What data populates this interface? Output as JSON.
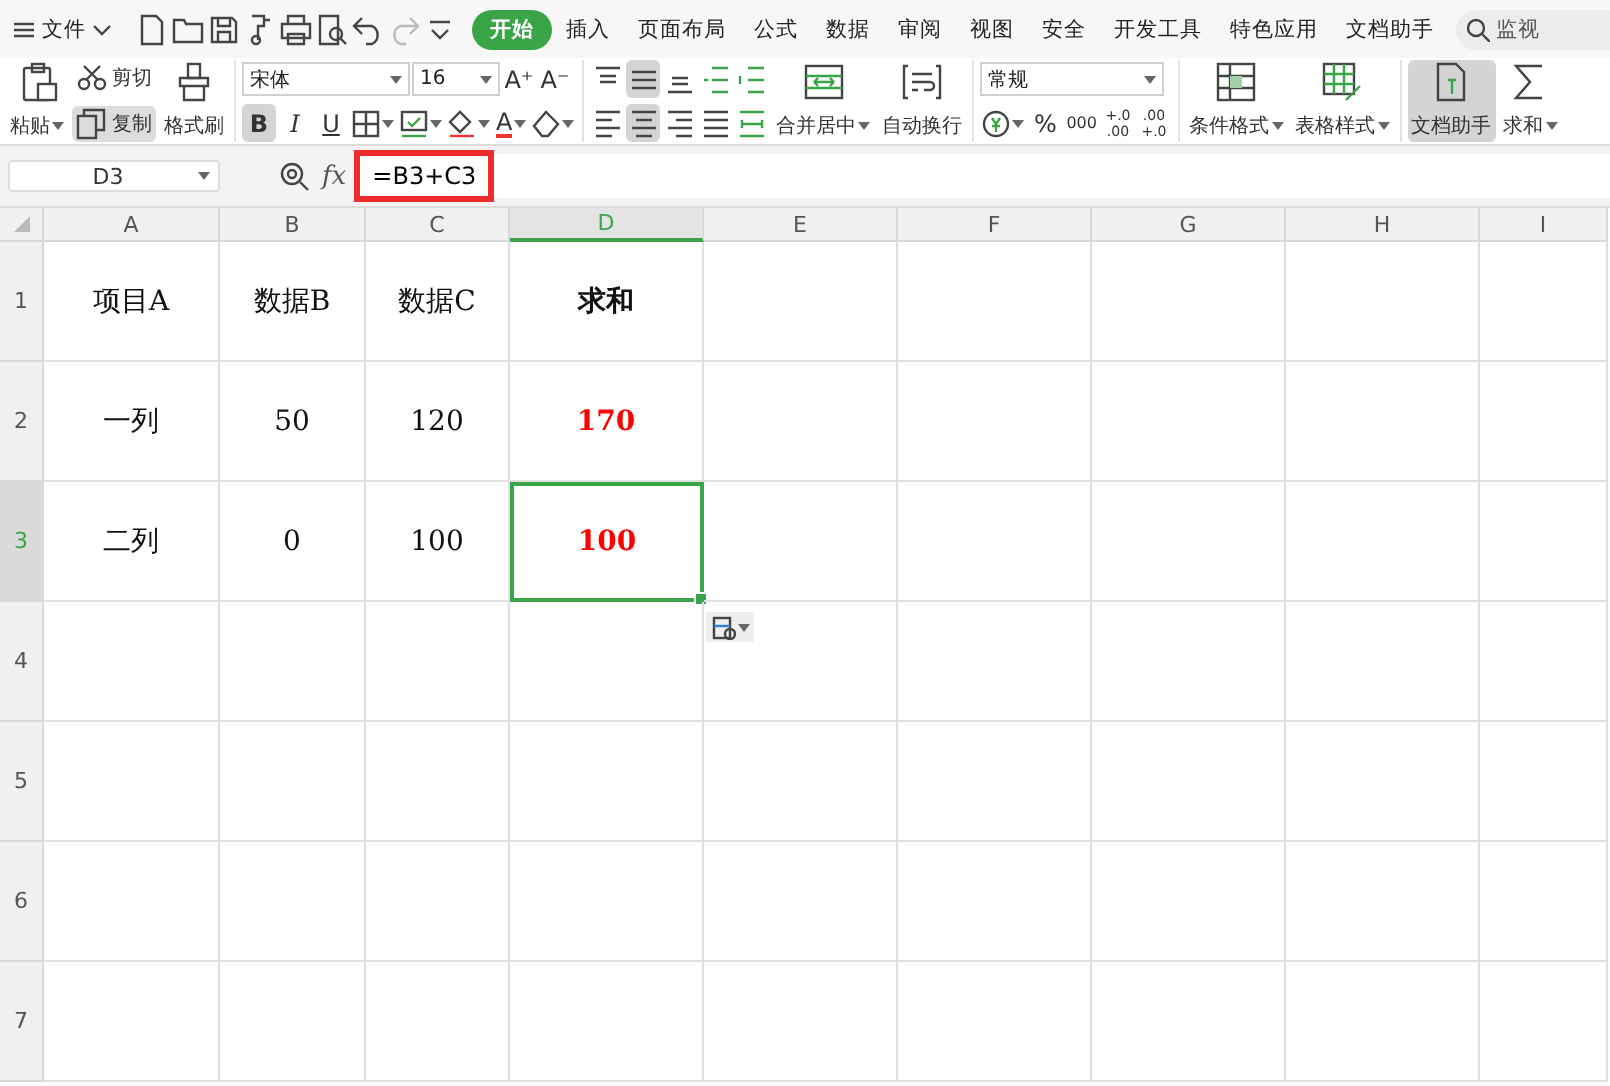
{
  "menu": {
    "file_label": "文件",
    "tabs": [
      {
        "label": "开始",
        "selected": true
      },
      {
        "label": "插入",
        "selected": false
      },
      {
        "label": "页面布局",
        "selected": false
      },
      {
        "label": "公式",
        "selected": false
      },
      {
        "label": "数据",
        "selected": false
      },
      {
        "label": "审阅",
        "selected": false
      },
      {
        "label": "视图",
        "selected": false
      },
      {
        "label": "安全",
        "selected": false
      },
      {
        "label": "开发工具",
        "selected": false
      },
      {
        "label": "特色应用",
        "selected": false
      },
      {
        "label": "文档助手",
        "selected": false
      }
    ],
    "search": {
      "placeholder": "监视"
    }
  },
  "ribbon": {
    "groups": [
      {
        "items": [
          {
            "kind": "large",
            "label": "粘贴",
            "dropdown": true,
            "active": false
          },
          {
            "kind": "stack",
            "items": [
              {
                "label": "剪切",
                "active": false
              },
              {
                "label": "复制",
                "active": true
              }
            ]
          },
          {
            "kind": "large",
            "label": "格式刷",
            "dropdown": false,
            "active": false
          }
        ]
      },
      {
        "items": [
          {
            "kind": "grid",
            "rows": [
              [
                {
                  "kind": "select",
                  "value": "宋体"
                },
                {
                  "kind": "select",
                  "value": "16"
                },
                {
                  "kind": "glyph",
                  "text": "A⁺",
                  "active": false,
                  "dropdown": false
                },
                {
                  "kind": "glyph",
                  "text": "A⁻",
                  "active": false,
                  "dropdown": false
                }
              ],
              [
                {
                  "kind": "glyph",
                  "text": "B",
                  "active": true,
                  "dropdown": false
                },
                {
                  "kind": "glyph",
                  "text": "I",
                  "active": false,
                  "dropdown": false
                },
                {
                  "kind": "glyph",
                  "text": "U",
                  "active": false,
                  "dropdown": false
                },
                {
                  "kind": "icon",
                  "active": false,
                  "dropdown": true
                },
                {
                  "kind": "icon",
                  "active": false,
                  "dropdown": true
                },
                {
                  "kind": "icon",
                  "active": false,
                  "dropdown": true
                },
                {
                  "kind": "glyph",
                  "text": "A",
                  "active": false,
                  "dropdown": true
                },
                {
                  "kind": "icon",
                  "active": false,
                  "dropdown": true
                }
              ]
            ]
          }
        ]
      },
      {
        "items": [
          {
            "kind": "grid",
            "rows": [
              [
                {
                  "kind": "icon",
                  "active": false,
                  "dropdown": false
                },
                {
                  "kind": "icon",
                  "active": true,
                  "dropdown": false
                },
                {
                  "kind": "icon",
                  "active": false,
                  "dropdown": false
                },
                {
                  "kind": "icon",
                  "active": false,
                  "dropdown": false
                },
                {
                  "kind": "icon",
                  "active": false,
                  "dropdown": false
                }
              ],
              [
                {
                  "kind": "icon",
                  "active": false,
                  "dropdown": false
                },
                {
                  "kind": "icon",
                  "active": true,
                  "dropdown": false
                },
                {
                  "kind": "icon",
                  "active": false,
                  "dropdown": false
                },
                {
                  "kind": "icon",
                  "active": false,
                  "dropdown": false
                },
                {
                  "kind": "icon",
                  "active": false,
                  "dropdown": false
                }
              ]
            ]
          },
          {
            "kind": "large",
            "label": "合并居中",
            "dropdown": true,
            "active": false
          },
          {
            "kind": "large",
            "label": "自动换行",
            "dropdown": false,
            "active": false
          }
        ]
      },
      {
        "items": [
          {
            "kind": "grid",
            "rows": [
              [
                {
                  "kind": "select",
                  "value": "常规"
                }
              ],
              [
                {
                  "kind": "icon",
                  "active": false,
                  "dropdown": true
                },
                {
                  "kind": "glyph",
                  "text": "%",
                  "active": false,
                  "dropdown": false
                },
                {
                  "kind": "glyph",
                  "text": "000",
                  "active": false,
                  "dropdown": false
                },
                {
                  "kind": "glyph",
                  "text": "+.0 .00",
                  "active": false,
                  "dropdown": false
                },
                {
                  "kind": "glyph",
                  "text": ".00 +.0",
                  "active": false,
                  "dropdown": false
                }
              ]
            ]
          }
        ]
      },
      {
        "items": [
          {
            "kind": "large",
            "label": "条件格式",
            "dropdown": true,
            "active": false
          },
          {
            "kind": "large",
            "label": "表格样式",
            "dropdown": true,
            "active": false
          }
        ]
      },
      {
        "items": [
          {
            "kind": "large",
            "label": "文档助手",
            "dropdown": false,
            "active": true
          },
          {
            "kind": "large",
            "label": "求和",
            "dropdown": true,
            "active": false
          }
        ]
      }
    ]
  },
  "formula_bar": {
    "name_box": "D3",
    "function_label": "fx",
    "formula": "=B3+C3",
    "formula_highlighted": true
  },
  "sheet": {
    "columns": [
      {
        "label": "A",
        "selected": false
      },
      {
        "label": "B",
        "selected": false
      },
      {
        "label": "C",
        "selected": false
      },
      {
        "label": "D",
        "selected": true
      },
      {
        "label": "E",
        "selected": false
      },
      {
        "label": "F",
        "selected": false
      },
      {
        "label": "G",
        "selected": false
      },
      {
        "label": "H",
        "selected": false
      },
      {
        "label": "I",
        "selected": false
      }
    ],
    "rows": [
      {
        "header": "1",
        "selected": false,
        "cells": [
          {
            "text": "项目A",
            "bold": false,
            "selected": false
          },
          {
            "text": "数据B",
            "bold": false,
            "selected": false
          },
          {
            "text": "数据C",
            "bold": false,
            "selected": false
          },
          {
            "text": "求和",
            "bold": true,
            "selected": false
          }
        ]
      },
      {
        "header": "2",
        "selected": false,
        "cells": [
          {
            "text": "一列",
            "bold": false,
            "selected": false
          },
          {
            "text": "50",
            "bold": false,
            "selected": false
          },
          {
            "text": "120",
            "bold": false,
            "selected": false
          },
          {
            "text": "170",
            "bold": true,
            "color": "#ff0000",
            "selected": false
          }
        ]
      },
      {
        "header": "3",
        "selected": true,
        "cells": [
          {
            "text": "二列",
            "bold": false,
            "selected": false
          },
          {
            "text": "0",
            "bold": false,
            "selected": false
          },
          {
            "text": "100",
            "bold": false,
            "selected": false
          },
          {
            "text": "100",
            "bold": true,
            "color": "#ff0000",
            "selected": true
          }
        ]
      },
      {
        "header": "4",
        "selected": false,
        "cells": []
      },
      {
        "header": "5",
        "selected": false,
        "cells": []
      },
      {
        "header": "6",
        "selected": false,
        "cells": []
      },
      {
        "header": "7",
        "selected": false,
        "cells": []
      }
    ],
    "paste_options": true
  }
}
